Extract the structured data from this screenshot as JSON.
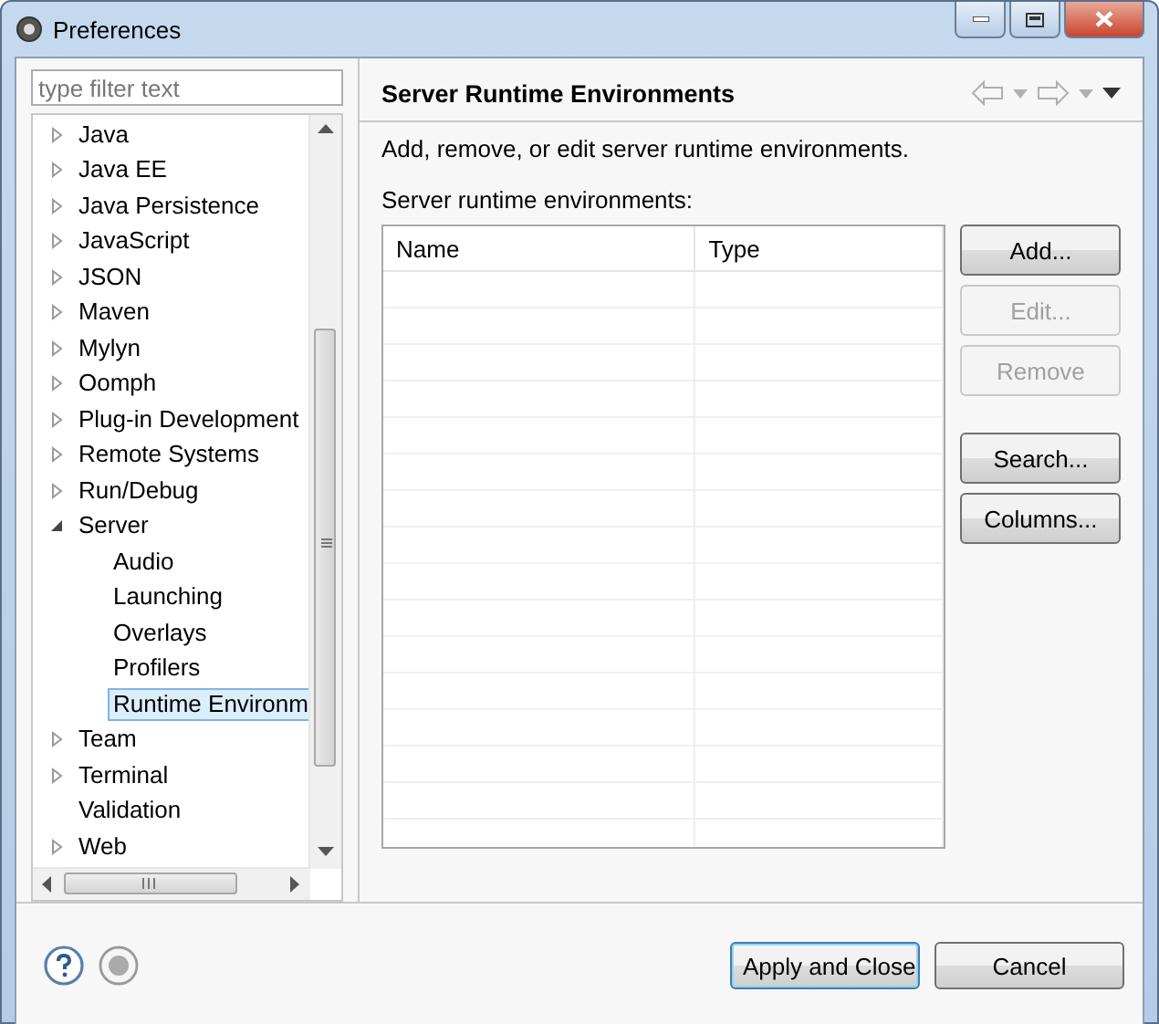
{
  "window": {
    "title": "Preferences"
  },
  "filter": {
    "placeholder": "type filter text"
  },
  "tree": {
    "items": [
      {
        "label": "Java",
        "expanded": false,
        "selected": false
      },
      {
        "label": "Java EE",
        "expanded": false,
        "selected": false
      },
      {
        "label": "Java Persistence",
        "expanded": false,
        "selected": false
      },
      {
        "label": "JavaScript",
        "expanded": false,
        "selected": false
      },
      {
        "label": "JSON",
        "expanded": false,
        "selected": false
      },
      {
        "label": "Maven",
        "expanded": false,
        "selected": false
      },
      {
        "label": "Mylyn",
        "expanded": false,
        "selected": false
      },
      {
        "label": "Oomph",
        "expanded": false,
        "selected": false
      },
      {
        "label": "Plug-in Development",
        "expanded": false,
        "selected": false
      },
      {
        "label": "Remote Systems",
        "expanded": false,
        "selected": false
      },
      {
        "label": "Run/Debug",
        "expanded": false,
        "selected": false
      },
      {
        "label": "Server",
        "expanded": true,
        "selected": false,
        "children": [
          {
            "label": "Audio",
            "selected": false
          },
          {
            "label": "Launching",
            "selected": false
          },
          {
            "label": "Overlays",
            "selected": false
          },
          {
            "label": "Profilers",
            "selected": false
          },
          {
            "label": "Runtime Environm",
            "selected": true
          }
        ]
      },
      {
        "label": "Team",
        "expanded": false,
        "selected": false
      },
      {
        "label": "Terminal",
        "expanded": false,
        "selected": false
      },
      {
        "label": "Validation",
        "selected": false
      },
      {
        "label": "Web",
        "expanded": false,
        "selected": false
      }
    ]
  },
  "page": {
    "title": "Server Runtime Environments",
    "description": "Add, remove, or edit server runtime environments.",
    "list_label": "Server runtime environments:",
    "table": {
      "columns": [
        "Name",
        "Type"
      ]
    },
    "buttons": [
      {
        "label": "Add...",
        "disabled": false
      },
      {
        "label": "Edit...",
        "disabled": true
      },
      {
        "label": "Remove",
        "disabled": true
      },
      {
        "label": "Search...",
        "disabled": false
      },
      {
        "label": "Columns...",
        "disabled": false
      }
    ]
  },
  "footer": {
    "buttons": [
      {
        "label": "Apply and Close",
        "default": true
      },
      {
        "label": "Cancel",
        "default": false
      }
    ]
  }
}
